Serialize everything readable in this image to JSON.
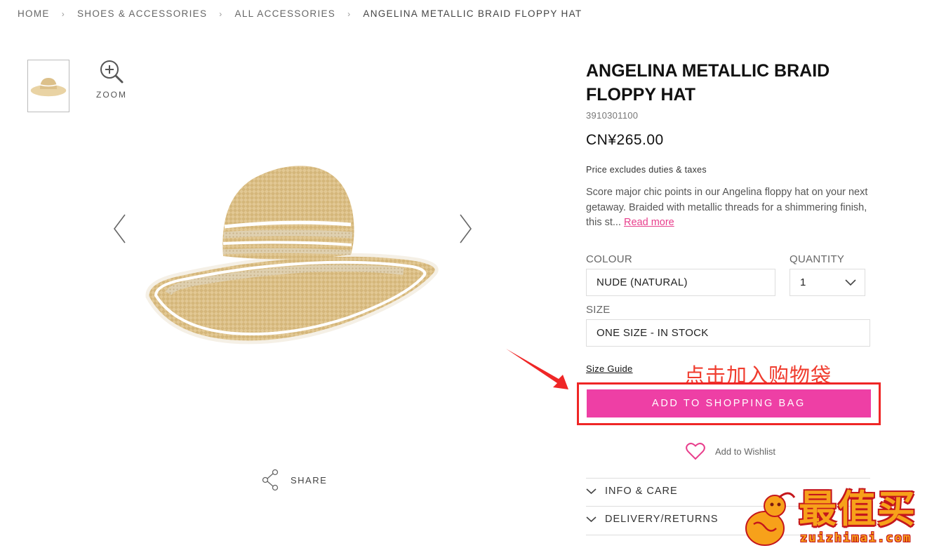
{
  "breadcrumb": {
    "home": "HOME",
    "category": "SHOES & ACCESSORIES",
    "subcategory": "ALL ACCESSORIES",
    "current": "ANGELINA METALLIC BRAID FLOPPY HAT",
    "separator": "›"
  },
  "gallery": {
    "zoom_label": "ZOOM",
    "share_label": "SHARE"
  },
  "product": {
    "title": "ANGELINA METALLIC BRAID FLOPPY HAT",
    "sku": "3910301100",
    "price": "CN¥265.00",
    "price_note": "Price excludes duties & taxes",
    "description": "Score major chic points in our Angelina floppy hat on your next getaway. Braided with metallic threads for a shimmering finish, this st...",
    "read_more": "Read more"
  },
  "options": {
    "colour_label": "COLOUR",
    "colour_value": "NUDE (NATURAL)",
    "quantity_label": "QUANTITY",
    "quantity_value": "1",
    "size_label": "SIZE",
    "size_value": "ONE SIZE - IN STOCK",
    "size_guide": "Size Guide"
  },
  "actions": {
    "add_to_bag": "ADD TO SHOPPING BAG",
    "wishlist": "Add to Wishlist"
  },
  "accordion": {
    "info_care": "INFO & CARE",
    "delivery_returns": "DELIVERY/RETURNS"
  },
  "annotation": {
    "text": "点击加入购物袋"
  },
  "watermark": {
    "big": "最值买",
    "small": "zuizhimai.com"
  },
  "colors": {
    "accent_pink": "#ee3fa5",
    "annotation_red": "#ef2626",
    "wishlist_heart": "#e83e8c"
  },
  "icons": {
    "zoom": "magnifier-plus-icon",
    "prev": "chevron-left-icon",
    "next": "chevron-right-icon",
    "share": "share-icon",
    "wishlist": "heart-icon",
    "dropdown": "chevron-down-icon",
    "accordion": "chevron-down-icon"
  }
}
